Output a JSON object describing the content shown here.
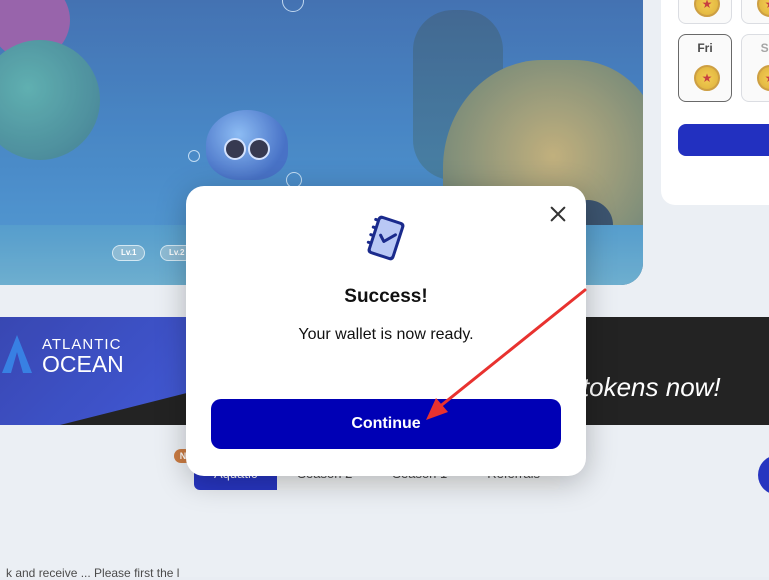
{
  "game": {
    "level_chips": [
      "Lv.1",
      "Lv.2"
    ]
  },
  "rewards_panel": {
    "days": [
      {
        "label": "Fri",
        "state": "active"
      },
      {
        "label": "Sa",
        "state": "upcoming"
      }
    ]
  },
  "banner": {
    "brand_line1": "ATLANTIC",
    "brand_line2": "OCEAN",
    "slogan": "est tokens now!",
    "exclaim": "!"
  },
  "tabs": {
    "badge": "N",
    "items": [
      "Aquatic",
      "Season 2",
      "Season 1",
      "Referrals"
    ],
    "active_index": 0
  },
  "footer": {
    "text": "k and receive ... Please first the l"
  },
  "modal": {
    "icon": "wallet-checklist-icon",
    "title": "Success!",
    "message": "Your wallet is now ready.",
    "continue_label": "Continue",
    "close_icon": "close-icon"
  },
  "annotation": {
    "color": "#e8322f",
    "target": "continue-button"
  },
  "colors": {
    "primary": "#0000b5",
    "banner_bg": "#050505",
    "ocean": "#2f76bd"
  }
}
